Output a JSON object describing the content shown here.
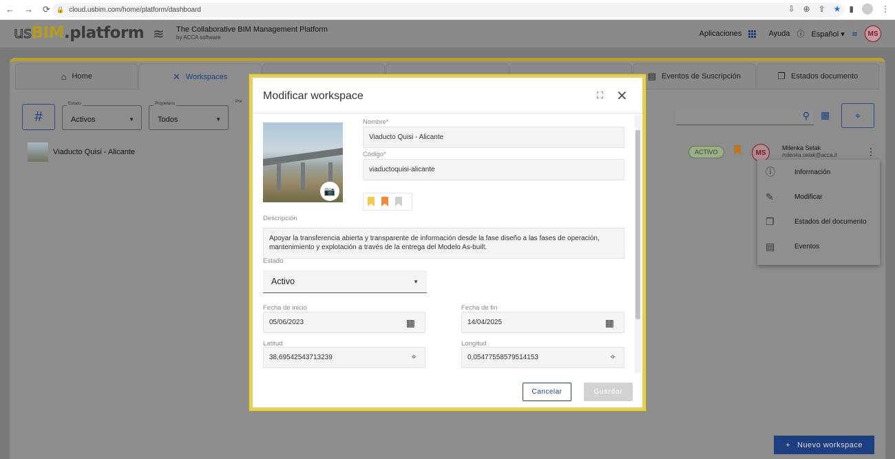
{
  "browser": {
    "url": "cloud.usbim.com/home/platform/dashboard"
  },
  "app": {
    "logo_us": "us",
    "logo_bim": "BIM",
    "logo_platform": ".platform",
    "tagline": "The Collaborative BIM Management Platform",
    "tagline_sub": "by ACCA software",
    "apps_label": "Aplicaciones",
    "help_label": "Ayuda",
    "lang_label": "Español",
    "avatar": "MS"
  },
  "tabs": [
    {
      "label": "Home",
      "icon": "home-icon"
    },
    {
      "label": "Workspaces",
      "icon": "tools-icon"
    },
    {
      "label": "",
      "icon": "users-icon"
    },
    {
      "label": "",
      "icon": "roles-icon"
    },
    {
      "label": "",
      "icon": "clock-icon"
    },
    {
      "label": "Eventos de Suscripción",
      "icon": "document-icon"
    },
    {
      "label": "Estados documento",
      "icon": "doc-states-icon"
    }
  ],
  "filters": {
    "estado_label": "Estado",
    "estado_value": "Activos",
    "propietario_label": "Propietario",
    "propietario_value": "Todos",
    "pre_label": "Pre"
  },
  "workspace_row": {
    "name": "Viaducto Quisi - Alicante",
    "status": "ACTIVO",
    "avatar": "MS",
    "user_name": "Milenka Selak",
    "user_email": "milenka.selak@acca.it"
  },
  "context_menu": [
    {
      "label": "Información",
      "icon": "info-icon"
    },
    {
      "label": "Modificar",
      "icon": "pencil-icon"
    },
    {
      "label": "Estados del documento",
      "icon": "doc-states-icon"
    },
    {
      "label": "Eventos",
      "icon": "events-icon"
    }
  ],
  "new_workspace": "Nuevo workspace",
  "modal": {
    "title": "Modificar workspace",
    "nombre_label": "Nombre*",
    "nombre_value": "Viaducto Quisi - Alicante",
    "codigo_label": "Código*",
    "codigo_value": "viaductoquisi-alicante",
    "descripcion_label": "Descripción",
    "descripcion_value": "Apoyar la transferencia abierta y transparente de información desde la fase diseño a las fases de operación, mantenimiento y explotación a través de la entrega del Modelo As-built.",
    "estado_label": "Estado",
    "estado_value": "Activo",
    "fecha_inicio_label": "Fecha de inicio",
    "fecha_inicio_value": "05/06/2023",
    "fecha_fin_label": "Fecha de fin",
    "fecha_fin_value": "14/04/2025",
    "latitud_label": "Latitud",
    "latitud_value": "38,69542543713239",
    "longitud_label": "Longitud",
    "longitud_value": "0,05477558579514153",
    "cancel_label": "Cancelar",
    "save_label": "Guardar",
    "bookmark_colors": [
      "#f2c94c",
      "#f08a3c",
      "#cfcfcf"
    ]
  }
}
